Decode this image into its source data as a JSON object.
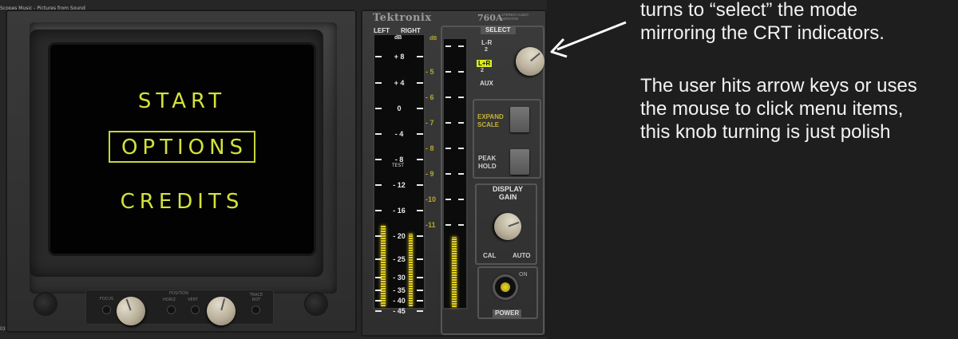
{
  "window": {
    "title": "Scopes Music - Pictures from Sound",
    "corner_number": "03"
  },
  "crt_menu": {
    "items": [
      {
        "label": "START",
        "selected": false
      },
      {
        "label": "OPTIONS",
        "selected": true
      },
      {
        "label": "CREDITS",
        "selected": false
      }
    ],
    "text_color": "#d4e23a"
  },
  "monitor_controls": {
    "left_knob_label": "FOCUS",
    "position_label": "POSITION",
    "horiz_label": "HORIZ",
    "vert_label": "VERT",
    "trace_label": "TRACE ROT"
  },
  "meter_panel": {
    "brand": "Tektronix",
    "model": "760A",
    "model_sub": "STEREO AUDIO MONITOR",
    "left_label": "LEFT",
    "right_label": "RIGHT",
    "db_unit": "dB",
    "db_unit_right": "dB",
    "test_label": "TEST",
    "left_scale": [
      "+ 8",
      "+ 4",
      "0",
      "- 4",
      "- 8",
      "- 12",
      "- 16",
      "- 20",
      "- 25",
      "- 30",
      "- 35",
      "- 40",
      "- 45"
    ],
    "right_scale": [
      "- 5",
      "- 6",
      "- 7",
      "- 8",
      "- 9",
      "-10",
      "-11"
    ],
    "levels": {
      "left_db": -20,
      "right_db": -21,
      "aux_db": -23
    }
  },
  "select_section": {
    "title": "SELECT",
    "options": [
      {
        "label": "L-R",
        "sub": "2",
        "active": false
      },
      {
        "label": "L+R",
        "sub": "2",
        "active": true
      },
      {
        "label": "AUX",
        "sub": "",
        "active": false
      }
    ]
  },
  "buttons": {
    "expand_scale": [
      "EXPAND",
      "SCALE"
    ],
    "peak_hold": [
      "PEAK",
      "HOLD"
    ]
  },
  "display_gain": {
    "title": [
      "DISPLAY",
      "GAIN"
    ],
    "cal": "CAL",
    "auto": "AUTO"
  },
  "power": {
    "on_label": "ON",
    "label": "POWER"
  },
  "annotation": {
    "lines_1": [
      "turns to “select” the mode",
      "mirroring the CRT indicators."
    ],
    "lines_2": [
      "The user hits arrow keys or uses",
      "the mouse to click menu items,",
      "this knob turning is just polish"
    ],
    "color": "#f2f2f2"
  }
}
